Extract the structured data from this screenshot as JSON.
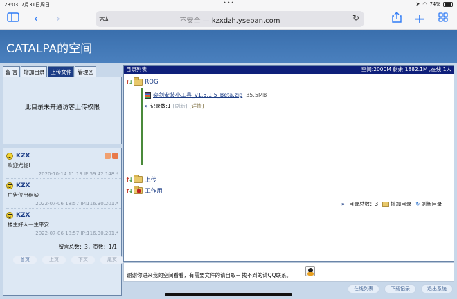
{
  "status_bar": {
    "time": "23:03",
    "date": "7月31日周日",
    "battery": "74%"
  },
  "browser": {
    "aa_label": "大ﾑ",
    "url_insecure": "不安全 —",
    "url_domain": "kzxdzh.ysepan.com"
  },
  "page": {
    "title": "CATALPA的空间"
  },
  "left_tabs": [
    {
      "label": "留 言"
    },
    {
      "label": "增加目录"
    },
    {
      "label": "上传文件"
    },
    {
      "label": "管理区"
    }
  ],
  "upload_box": {
    "message": "此目录未开通访客上传权限"
  },
  "messages": [
    {
      "name": "KZX",
      "text": "欢迎光临!",
      "meta": "2020-10-14 11:13 IP:59.42.148.*"
    },
    {
      "name": "KZX",
      "text": "广告位出租😀",
      "meta": "2022-07-06 18:57 IP:116.30.201.*"
    },
    {
      "name": "KZX",
      "text": "楼主好人一生平安",
      "meta": "2022-07-06 18:57 IP:116.30.201.*"
    }
  ],
  "message_summary": "留言总数：3，页数：1/1",
  "pager": [
    "首页",
    "上页",
    "下页",
    "尾页"
  ],
  "directory": {
    "header_title": "目录列表",
    "header_stats": "空间:2000M 剩余:1882.1M ,在线:1人",
    "folders": [
      {
        "name": "ROG"
      },
      {
        "name": "上传"
      },
      {
        "name": "工作用"
      }
    ],
    "file": {
      "name": "奕剑安装小工具_v1.5.1.5_Beta.zip",
      "size": "35.5MB"
    },
    "record": {
      "count_label": "记录数:1",
      "refresh": "[刷新]",
      "detail": "[详情]"
    },
    "footer": {
      "total": "目录总数：3",
      "add_dir": "增加目录",
      "refresh_dir": "刷新目录"
    }
  },
  "notice": "谢谢你进来我的空间看看，有需要文件的请自取~ 找不到的请QQ联系。",
  "bottom_buttons": [
    "在线列表",
    "下载记录",
    "退出系统"
  ]
}
